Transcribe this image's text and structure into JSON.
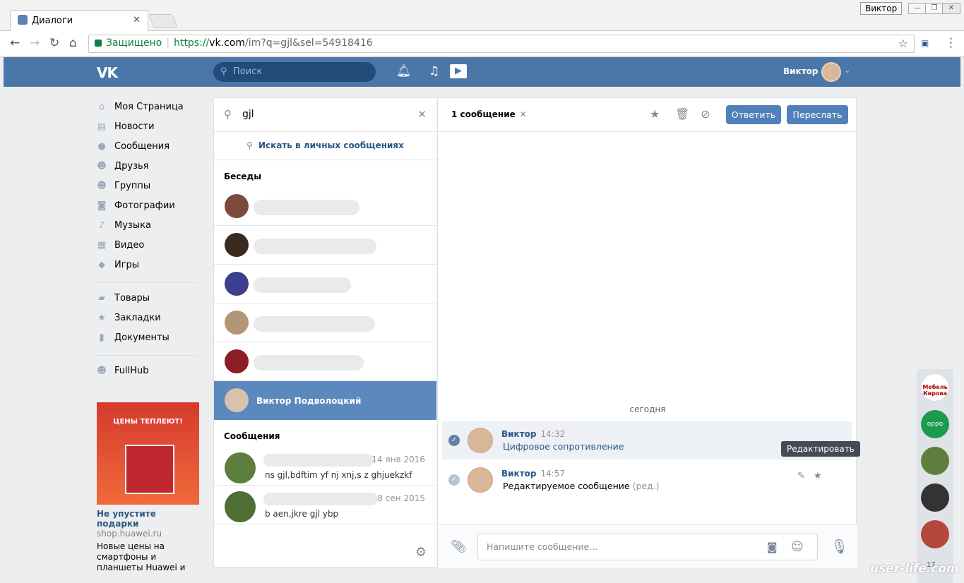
{
  "browser": {
    "tab_title": "Диалоги",
    "tab_close": "✕",
    "profile_badge": "Виктор",
    "address": {
      "security": "Защищено",
      "protocol": "https://",
      "host": "vk.com",
      "path": "/im?q=gjl&sel=54918416"
    }
  },
  "header": {
    "logo": "VK",
    "search_placeholder": "Поиск",
    "user_name": "Виктор"
  },
  "sidebar": {
    "items": [
      {
        "label": "Моя Страница",
        "icon": "home-icon"
      },
      {
        "label": "Новости",
        "icon": "news-icon"
      },
      {
        "label": "Сообщения",
        "icon": "messages-icon"
      },
      {
        "label": "Друзья",
        "icon": "friends-icon"
      },
      {
        "label": "Группы",
        "icon": "groups-icon"
      },
      {
        "label": "Фотографии",
        "icon": "camera-icon"
      },
      {
        "label": "Музыка",
        "icon": "music-icon"
      },
      {
        "label": "Видео",
        "icon": "video-icon"
      },
      {
        "label": "Игры",
        "icon": "games-icon"
      },
      {
        "label": "Товары",
        "icon": "bag-icon"
      },
      {
        "label": "Закладки",
        "icon": "star-icon"
      },
      {
        "label": "Документы",
        "icon": "document-icon"
      },
      {
        "label": "FullHub",
        "icon": "app-icon"
      }
    ]
  },
  "ad": {
    "banner_text": "ЦЕНЫ ТЕПЛЕЮТ!",
    "title": "Не упустите подарки",
    "site": "shop.huawei.ru",
    "text": "Новые цены на смартфоны и планшеты Huawei и Honor Вас удивят. Подарок при покупке"
  },
  "dialogs": {
    "search_value": "gjl",
    "search_in_messages": "Искать в личных сообщениях",
    "conversations_header": "Беседы",
    "selected_name": "Виктор Подволоцкий",
    "messages_header": "Сообщения",
    "messages": [
      {
        "date": "14 янв 2016",
        "text": "ns gjl,bdftim yf nj xnj,s z ghjuekzkf"
      },
      {
        "date": "8 сен 2015",
        "text": "b aen,jkre gjl ybp"
      }
    ]
  },
  "chat": {
    "selected_count": "1 сообщение",
    "reply_button": "Ответить",
    "forward_button": "Переслать",
    "day_separator": "сегодня",
    "messages": [
      {
        "author": "Виктор",
        "time": "14:32",
        "text": "Цифровое сопротивление"
      },
      {
        "author": "Виктор",
        "time": "14:57",
        "text": "Редактируемое сообщение",
        "edited": "(ред.)"
      }
    ],
    "tooltip": "Редактировать",
    "composer_placeholder": "Напишите сообщение..."
  },
  "right_stack": {
    "counter": "17",
    "first_label": "Мебель Кирова",
    "second_label": "oppo"
  },
  "watermark": "user-life.com",
  "colors": {
    "vk_blue": "#4a76a8",
    "button": "#5181b8",
    "selected": "#5b88bd",
    "link": "#2a5885"
  }
}
